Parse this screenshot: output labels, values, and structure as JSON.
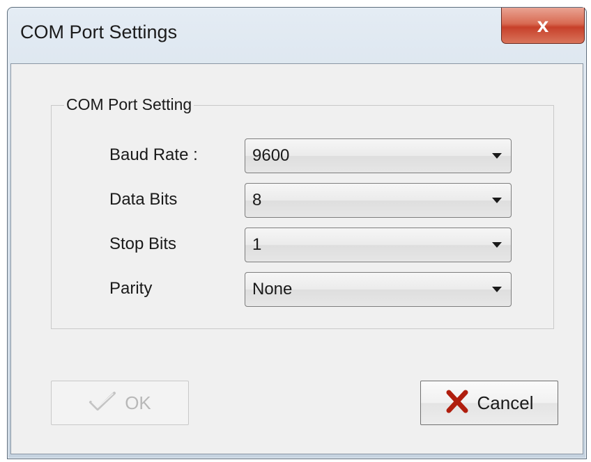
{
  "window": {
    "title": "COM Port Settings",
    "close_glyph": "x"
  },
  "group": {
    "label": "COM Port Setting"
  },
  "fields": [
    {
      "label": "Baud Rate :",
      "value": "9600"
    },
    {
      "label": "Data Bits",
      "value": "8"
    },
    {
      "label": "Stop Bits",
      "value": "1"
    },
    {
      "label": "Parity",
      "value": "None"
    }
  ],
  "buttons": {
    "ok": {
      "label": "OK",
      "icon": "checkmark-icon",
      "enabled": false
    },
    "cancel": {
      "label": "Cancel",
      "icon": "red-x-icon",
      "icon_color": "#b01e0e"
    }
  }
}
